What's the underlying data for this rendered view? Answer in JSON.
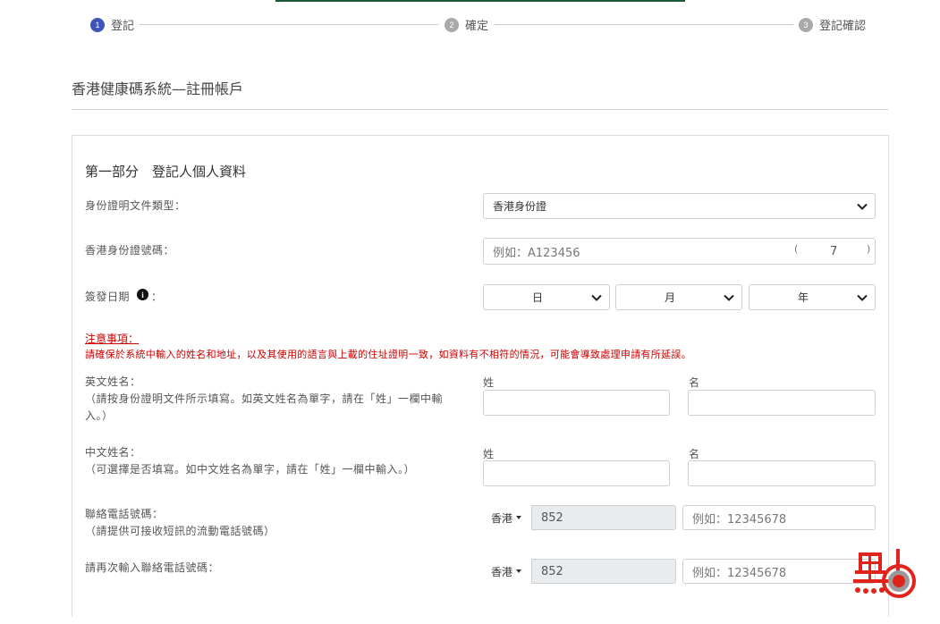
{
  "stepper": {
    "steps": [
      {
        "num": "1",
        "label": "登記"
      },
      {
        "num": "2",
        "label": "確定"
      },
      {
        "num": "3",
        "label": "登記確認"
      }
    ]
  },
  "page": {
    "title": "香港健康碼系統—註冊帳戶"
  },
  "section": {
    "title": "第一部分　登記人個人資料"
  },
  "form": {
    "doc_type_label": "身份證明文件類型：",
    "doc_type_value": "香港身份證",
    "id_number_label": "香港身份證號碼：",
    "id_number_placeholder": "例如：A123456",
    "check_digit_open": "(",
    "check_digit_value": "7",
    "check_digit_close": ")",
    "issue_date_label": "簽發日期",
    "issue_date_colon": "：",
    "day_value": "日",
    "month_value": "月",
    "year_value": "年",
    "notice_title": "注意事項：",
    "notice_text": "請確保於系統中輸入的姓名和地址，以及其使用的語言與上載的住址證明一致，如資料有不相符的情況，可能會導致處理申請有所延誤。",
    "eng_name_label": "英文姓名：",
    "eng_name_hint_1": "（請按身份證明文件所示填寫。如英文姓名為單字，請在「姓」一欄中輸",
    "eng_name_hint_2": "入。）",
    "surname_label": "姓",
    "given_name_label": "名",
    "chi_name_label": "中文姓名：",
    "chi_name_hint": "（可選擇是否填寫。如中文姓名為單字，請在「姓」一欄中輸入。）",
    "phone_label": "聯絡電話號碼：",
    "phone_hint": "（請提供可接收短訊的流動電話號碼）",
    "phone_region": "香港",
    "phone_code": "852",
    "phone_placeholder": "例如：12345678",
    "phone_confirm_label": "請再次輸入聯絡電話號碼：",
    "info_icon_glyph": "i"
  },
  "colors": {
    "accent": "#3d54b8",
    "step_inactive": "#a9a9a9",
    "notice_red": "#cc0000",
    "top_bar": "#1d5a3a",
    "logo_red": "#e0231b"
  }
}
